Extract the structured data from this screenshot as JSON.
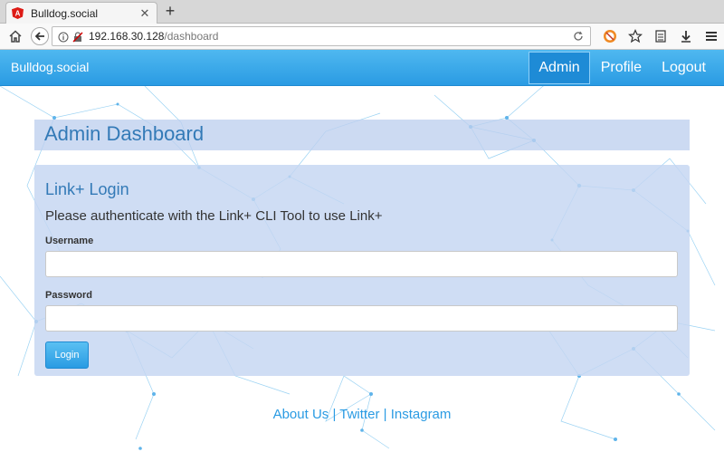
{
  "browser": {
    "tab_title": "Bulldog.social",
    "tab_close": "✕",
    "new_tab": "+",
    "url_host": "192.168.30.128",
    "url_path": "/dashboard"
  },
  "site": {
    "brand": "Bulldog.social",
    "nav": [
      "Admin",
      "Profile",
      "Logout"
    ]
  },
  "header": {
    "title": "Admin Dashboard"
  },
  "login": {
    "title": "Link+ Login",
    "subtitle": "Please authenticate with the Link+ CLI Tool to use Link+",
    "username_label": "Username",
    "username_value": "",
    "password_label": "Password",
    "password_value": "",
    "button_label": "Login"
  },
  "footer": {
    "links": [
      "About Us",
      "Twitter",
      "Instagram"
    ],
    "separator": "|"
  },
  "colors": {
    "nav_bg": "#2a9be3",
    "accent": "#337ab7",
    "panel": "#c4d5f1"
  },
  "icons": [
    "home-icon",
    "back-arrow-icon",
    "info-icon",
    "insecure-lock-icon",
    "reload-icon",
    "extension-icon",
    "star-icon",
    "reader-icon",
    "download-icon",
    "menu-icon"
  ]
}
